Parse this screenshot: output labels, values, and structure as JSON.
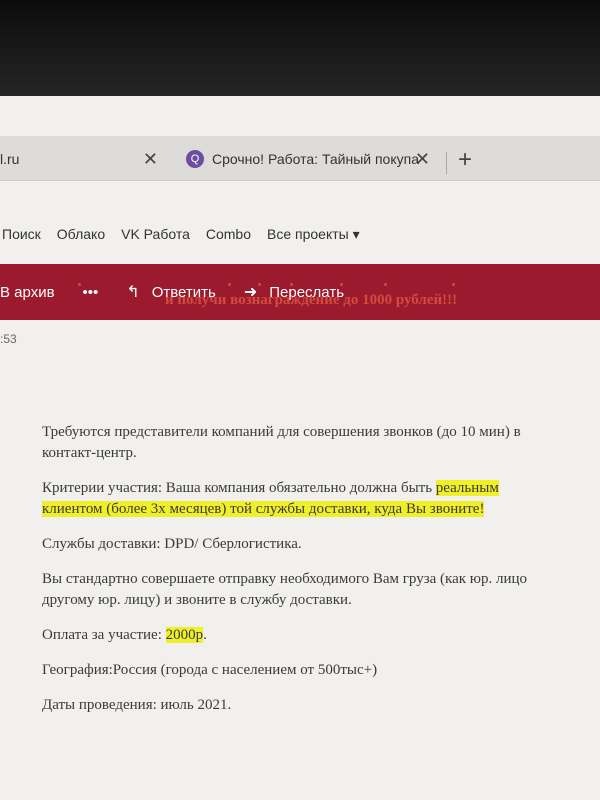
{
  "tabs": [
    {
      "label": "l.ru",
      "close": "✕"
    },
    {
      "label": "Срочно! Работа: Тайный покупа",
      "close": "✕",
      "favicon": "Q"
    }
  ],
  "new_tab": "+",
  "portal_nav": [
    "Поиск",
    "Облако",
    "VK Работа",
    "Combo",
    "Все проекты ▾"
  ],
  "toolbar": {
    "archive": "В архив",
    "more": "•••",
    "reply": "Ответить",
    "forward": "Переслать"
  },
  "time": ":53",
  "email": {
    "headline": "и получи вознаграждение до 1000 рублей!!!",
    "p1": "Требуются представители компаний для совершения звонков (до 10 мин) в",
    "p1b": "контакт-центр.",
    "p2a": "Критерии участия: Ваша компания обязательно должна быть ",
    "p2_hl1": "реальным",
    "p2_hl2": "клиентом (более 3х месяцев) той службы доставки, куда Вы звоните!",
    "p3": "Службы доставки: DPD/ Сберлогистика.",
    "p4a": "Вы стандартно совершаете отправку необходимого Вам груза (как юр. лицо",
    "p4b": "другому юр. лицу) и звоните в службу доставки.",
    "p5a": "Оплата за участие: ",
    "p5_hl": "2000р",
    "p5b": ".",
    "p6": "География:Россия (города с населением от 500тыс+)",
    "p7": "Даты проведения: июль 2021."
  }
}
